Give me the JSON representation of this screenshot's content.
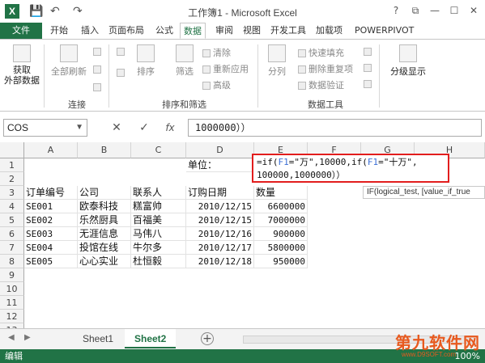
{
  "window": {
    "title": "工作簿1 - Microsoft Excel",
    "app_icon_letter": "X"
  },
  "qat": {
    "save": "💾",
    "undo": "↶",
    "redo": "↷"
  },
  "window_buttons": {
    "help": "?",
    "restore": "⧉",
    "minimize": "—",
    "maximize": "☐",
    "close": "✕"
  },
  "tabs": [
    "文件",
    "开始",
    "插入",
    "页面布局",
    "公式",
    "数据",
    "审阅",
    "视图",
    "开发工具",
    "加载项",
    "POWERPIVOT"
  ],
  "active_tab": "数据",
  "ribbon": {
    "get_external_data": "获取\n外部数据",
    "refresh_all": "全部刷新",
    "sort": "排序",
    "filter": "筛选",
    "clear": "清除",
    "reapply": "重新应用",
    "advanced": "高级",
    "split": "分列",
    "flash_fill": "快速填充",
    "remove_duplicates": "删除重复项",
    "data_validation": "数据验证",
    "group_show": "分级显示",
    "group_connections": "连接",
    "group_sort_filter": "排序和筛选",
    "group_data_tools": "数据工具"
  },
  "formula_bar": {
    "name_box": "COS",
    "cancel": "✕",
    "enter": "✓",
    "fx": "fx",
    "content": "1000000））"
  },
  "columns": [
    "A",
    "B",
    "C",
    "D",
    "E",
    "F",
    "G",
    "H"
  ],
  "rows": [
    "1",
    "2",
    "3",
    "4",
    "5",
    "6",
    "7",
    "8",
    "9",
    "10",
    "11",
    "12",
    "13"
  ],
  "sheet": {
    "d1": "单位：",
    "headers": [
      "订单编号",
      "公司",
      "联系人",
      "订购日期",
      "数量"
    ],
    "records": [
      [
        "SE001",
        "欧泰科技",
        "糕富帅",
        "2010/12/15",
        "6600000"
      ],
      [
        "SE002",
        "乐然厨具",
        "百福美",
        "2010/12/15",
        "7000000"
      ],
      [
        "SE003",
        "无涯信息",
        "马伟八",
        "2010/12/16",
        "900000"
      ],
      [
        "SE004",
        "投馆在线",
        "牛尔多",
        "2010/12/17",
        "5800000"
      ],
      [
        "SE005",
        "心心实业",
        "杜恒毅",
        "2010/12/18",
        "950000"
      ]
    ]
  },
  "edit_formula": {
    "p1": "=if(",
    "ref1": "F1",
    "p2": "=\"万\",10000,if(",
    "ref2": "F1",
    "p3": "=\"十万\",",
    "line2": "100000,1000000））"
  },
  "tooltip": "IF(logical_test, [value_if_true",
  "sheet_tabs": [
    "Sheet1",
    "Sheet2"
  ],
  "active_sheet": "Sheet2",
  "add_sheet": "+",
  "status": {
    "mode": "编辑",
    "zoom": "100%"
  },
  "watermark": {
    "main": "第九软件网",
    "sub": "www.D9SOFT.com"
  }
}
